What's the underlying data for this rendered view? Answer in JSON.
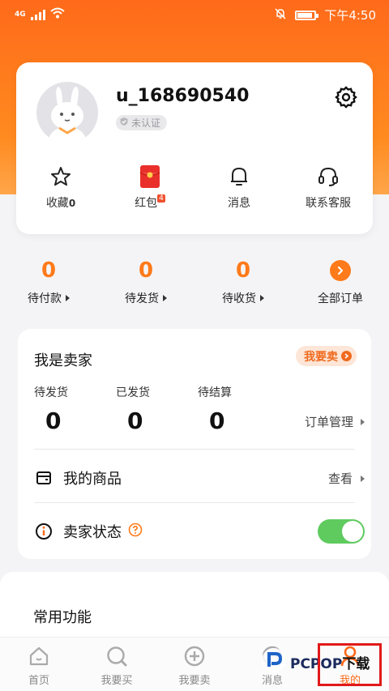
{
  "status": {
    "network": "4G",
    "time": "下午4:50"
  },
  "profile": {
    "username": "u_168690540",
    "verify": "未认证",
    "quick": [
      {
        "label": "收藏",
        "badge": "0",
        "icon": "star-icon"
      },
      {
        "label": "红包",
        "badge": "4",
        "icon": "red-envelope-icon"
      },
      {
        "label": "消息",
        "badge": "",
        "icon": "bell-icon"
      },
      {
        "label": "联系客服",
        "badge": "",
        "icon": "headset-icon"
      }
    ]
  },
  "orders": [
    {
      "count": "0",
      "label": "待付款"
    },
    {
      "count": "0",
      "label": "待发货"
    },
    {
      "count": "0",
      "label": "待收货"
    },
    {
      "count": "",
      "label": "全部订单"
    }
  ],
  "seller": {
    "title": "我是卖家",
    "sell_button": "我要卖",
    "stats": [
      {
        "label": "待发货",
        "value": "0"
      },
      {
        "label": "已发货",
        "value": "0"
      },
      {
        "label": "待结算",
        "value": "0"
      }
    ],
    "manage": "订单管理",
    "goods": {
      "label": "我的商品",
      "action": "查看"
    },
    "status": {
      "label": "卖家状态",
      "toggle_on": true
    }
  },
  "common": {
    "title": "常用功能"
  },
  "tabs": [
    {
      "label": "首页",
      "icon": "home-icon"
    },
    {
      "label": "我要买",
      "icon": "buy-icon"
    },
    {
      "label": "我要卖",
      "icon": "sell-plus-icon"
    },
    {
      "label": "消息",
      "icon": "message-icon"
    },
    {
      "label": "我的",
      "icon": "person-icon"
    }
  ],
  "watermark": {
    "brand": "PCPOP",
    "suffix": "下载"
  },
  "colors": {
    "accent": "#ff7a1a",
    "toggle": "#5fcb5f",
    "highlight": "#e11919"
  }
}
